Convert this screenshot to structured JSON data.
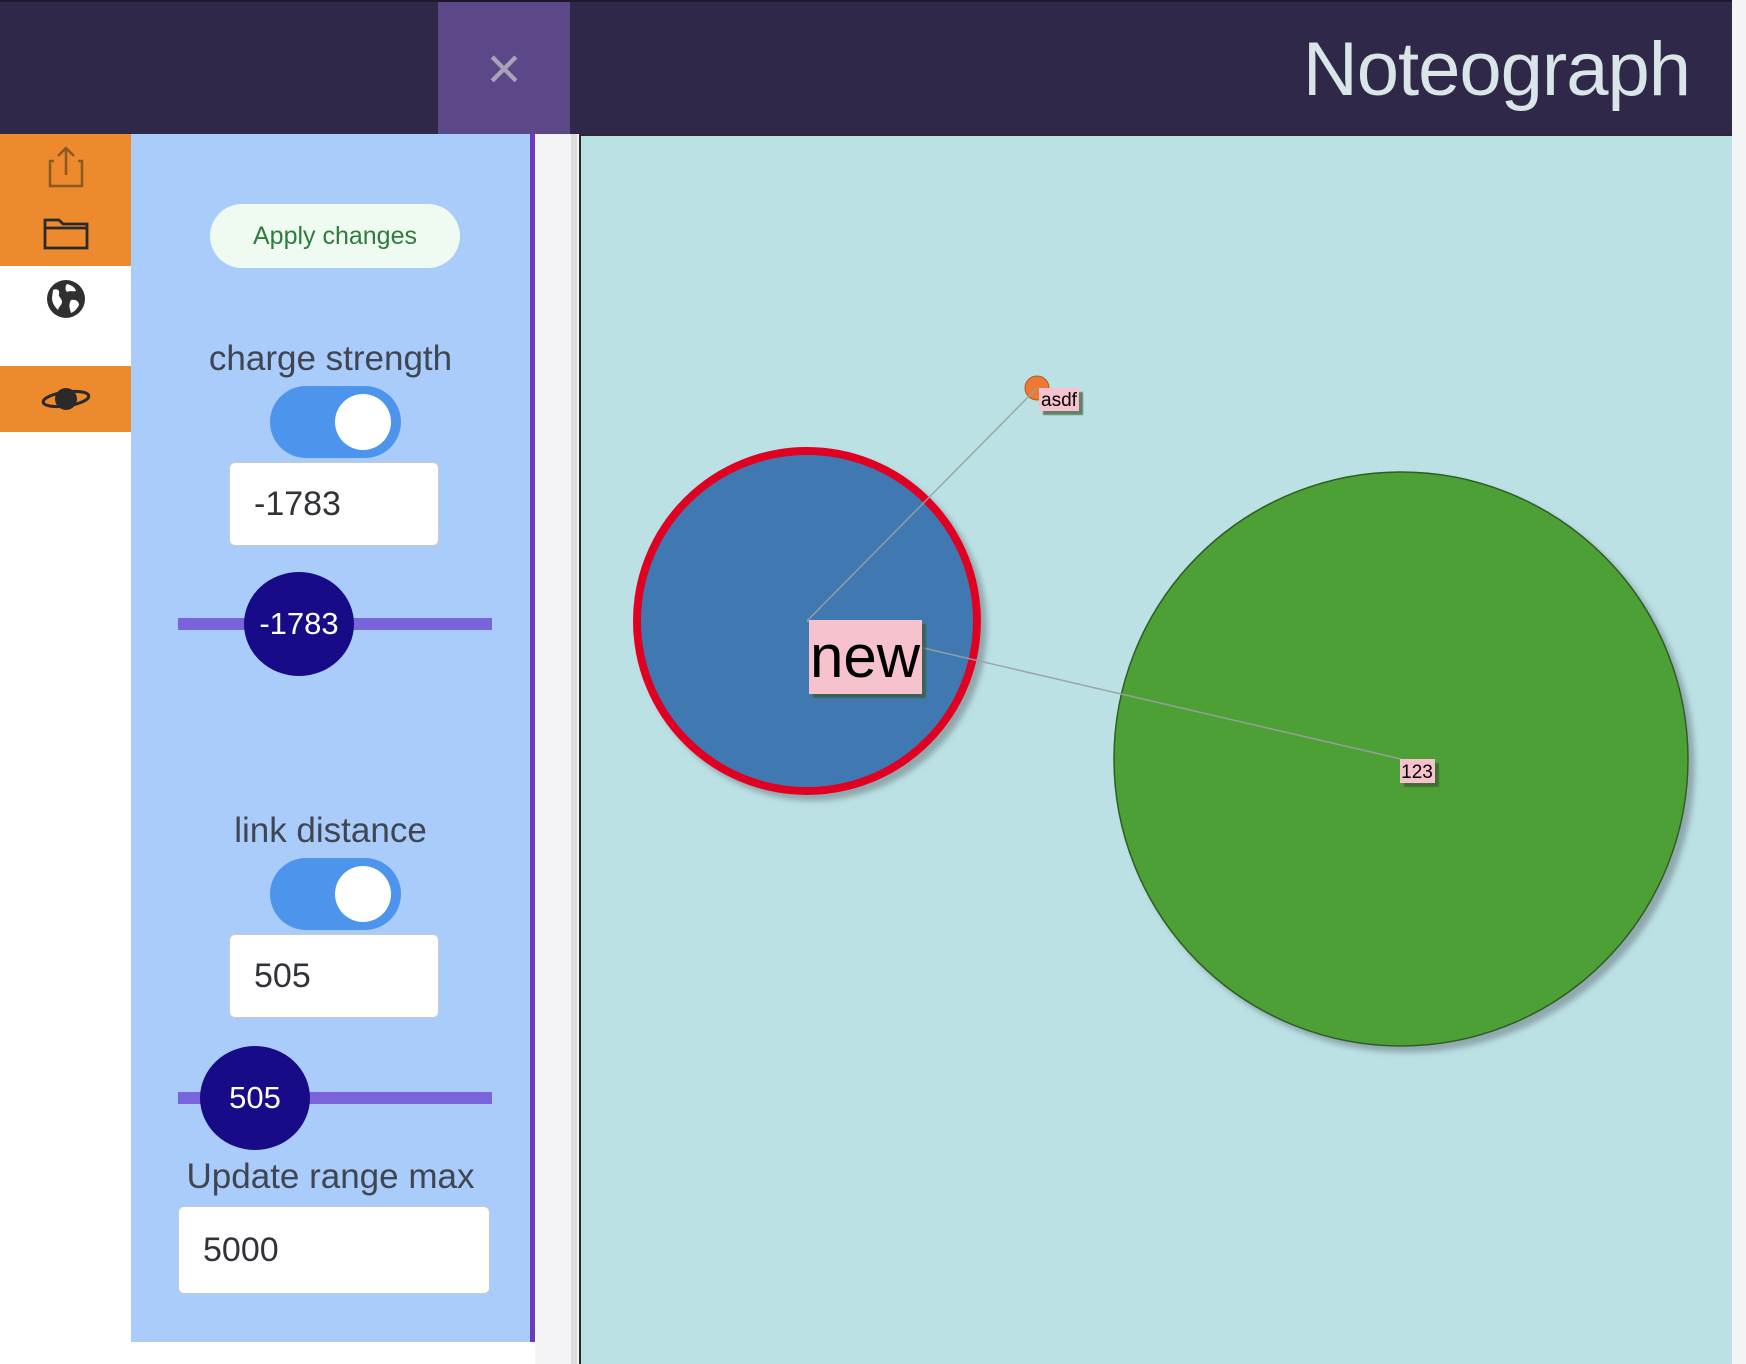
{
  "header": {
    "close_label": "×",
    "title": "Noteograph"
  },
  "rail": {
    "items": [
      {
        "icon": "share-icon",
        "active": false
      },
      {
        "icon": "folder-icon",
        "active": false
      },
      {
        "icon": "globe-icon",
        "active": true
      },
      {
        "icon": "planet-icon",
        "active": false
      }
    ]
  },
  "settings": {
    "apply_label": "Apply changes",
    "charge": {
      "label": "charge strength",
      "enabled": true,
      "value": "-1783",
      "slider_label": "-1783"
    },
    "link": {
      "label": "link distance",
      "enabled": true,
      "value": "505",
      "slider_label": "505"
    },
    "range": {
      "label": "Update range max",
      "value": "5000"
    }
  },
  "graph": {
    "nodes": [
      {
        "id": "new",
        "label": "new",
        "color": "#4079b1",
        "stroke": "#e00024"
      },
      {
        "id": "asdf",
        "label": "asdf",
        "color": "#ec7a34"
      },
      {
        "id": "123",
        "label": "123",
        "color": "#4ea034"
      }
    ],
    "edges": [
      {
        "from": "new",
        "to": "asdf"
      },
      {
        "from": "new",
        "to": "123"
      }
    ],
    "colors": {
      "background": "#bbe1e5",
      "label_bg": "#f6c2cd",
      "edge": "#9aa0a4"
    }
  }
}
